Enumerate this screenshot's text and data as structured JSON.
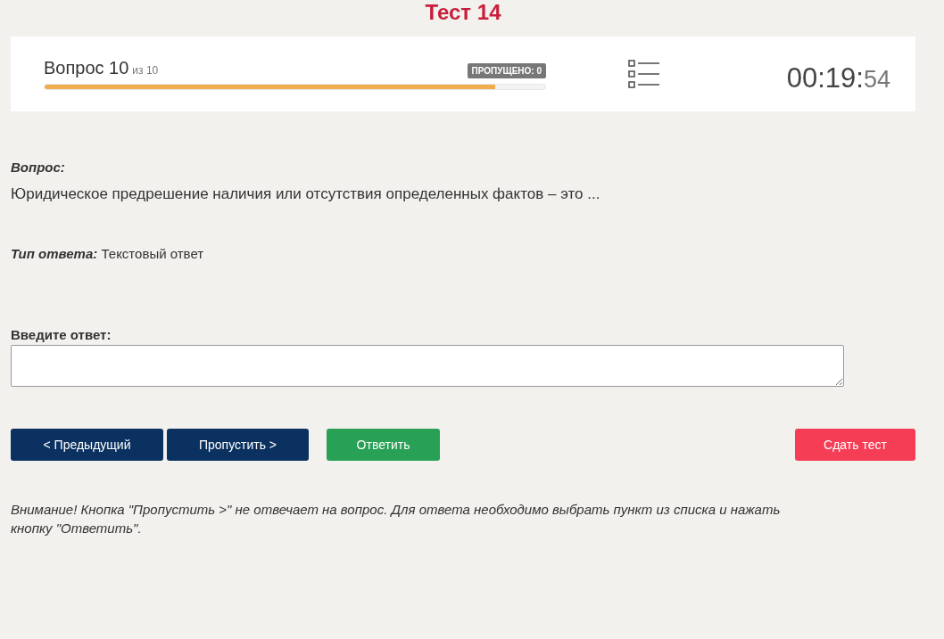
{
  "title": "Тест 14",
  "header": {
    "question_label": "Вопрос 10",
    "question_total": "из 10",
    "skipped_badge": "ПРОПУЩЕНО: 0",
    "progress": {
      "level": 0.9
    },
    "timer": {
      "main": "00:19:",
      "seconds": "54"
    }
  },
  "question": {
    "label": "Вопрос:",
    "text": "Юридическое предрешение наличия или отсутствия определенных фактов – это ..."
  },
  "answer_type": {
    "label": "Тип ответа:",
    "value": "Текстовый ответ"
  },
  "answer_field": {
    "label": "Введите ответ:"
  },
  "buttons": [
    {
      "label": "< Предыдущий",
      "kind": "navigate"
    },
    {
      "label": "Пропустить >",
      "kind": "navigate"
    },
    {
      "label": "Ответить",
      "kind": "answer"
    },
    {
      "label": "Сдать тест",
      "kind": "finish"
    }
  ],
  "note": "Внимание! Кнопка \"Пропустить >\" не отвечает на вопрос. Для ответа необходимо выбрать пункт из списка и нажать кнопку \"Ответить\"."
}
